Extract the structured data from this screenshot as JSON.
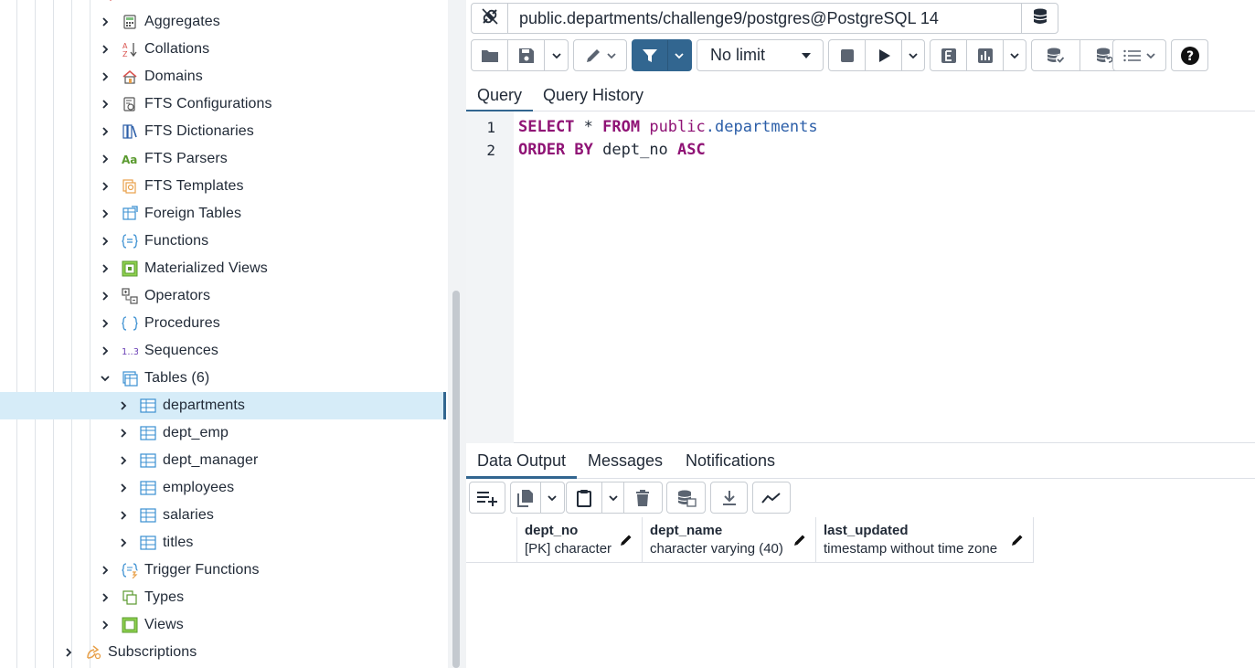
{
  "tree": {
    "items": [
      {
        "label": "Aggregates",
        "icon": "aggregate-icon",
        "expanded": false
      },
      {
        "label": "Collations",
        "icon": "collation-icon",
        "expanded": false
      },
      {
        "label": "Domains",
        "icon": "domain-icon",
        "expanded": false
      },
      {
        "label": "FTS Configurations",
        "icon": "fts-configuration-icon",
        "expanded": false
      },
      {
        "label": "FTS Dictionaries",
        "icon": "fts-dictionary-icon",
        "expanded": false
      },
      {
        "label": "FTS Parsers",
        "icon": "fts-parser-icon",
        "expanded": false
      },
      {
        "label": "FTS Templates",
        "icon": "fts-template-icon",
        "expanded": false
      },
      {
        "label": "Foreign Tables",
        "icon": "foreign-table-icon",
        "expanded": false
      },
      {
        "label": "Functions",
        "icon": "function-icon",
        "expanded": false
      },
      {
        "label": "Materialized Views",
        "icon": "materialized-view-icon",
        "expanded": false
      },
      {
        "label": "Operators",
        "icon": "operator-icon",
        "expanded": false
      },
      {
        "label": "Procedures",
        "icon": "procedure-icon",
        "expanded": false
      },
      {
        "label": "Sequences",
        "icon": "sequence-icon",
        "expanded": false
      },
      {
        "label": "Tables (6)",
        "icon": "tables-icon",
        "expanded": true
      }
    ],
    "tables": [
      {
        "label": "departments",
        "selected": true
      },
      {
        "label": "dept_emp",
        "selected": false
      },
      {
        "label": "dept_manager",
        "selected": false
      },
      {
        "label": "employees",
        "selected": false
      },
      {
        "label": "salaries",
        "selected": false
      },
      {
        "label": "titles",
        "selected": false
      }
    ],
    "after": [
      {
        "label": "Trigger Functions",
        "icon": "trigger-function-icon"
      },
      {
        "label": "Types",
        "icon": "type-icon"
      },
      {
        "label": "Views",
        "icon": "view-icon"
      }
    ],
    "subscriptions": {
      "label": "Subscriptions",
      "icon": "subscription-icon"
    }
  },
  "connection": {
    "text": "public.departments/challenge9/postgres@PostgreSQL 14"
  },
  "toolbar": {
    "limit": "No limit"
  },
  "query_tabs": [
    "Query",
    "Query History"
  ],
  "editor": {
    "line_numbers": [
      "1",
      "2"
    ],
    "line1": {
      "kw1": "SELECT",
      "star": " * ",
      "kw2": "FROM",
      "schema": " public",
      "dot": ".",
      "table": "departments"
    },
    "line2": {
      "kw1": "ORDER",
      "kw2": " BY",
      "col": " dept_no ",
      "kw3": "ASC"
    }
  },
  "output_tabs": [
    "Data Output",
    "Messages",
    "Notifications"
  ],
  "grid": {
    "columns": [
      {
        "name": "dept_no",
        "type": "[PK] character"
      },
      {
        "name": "dept_name",
        "type": "character varying (40)"
      },
      {
        "name": "last_updated",
        "type": "timestamp without time zone"
      }
    ]
  },
  "colors": {
    "accent": "#326690",
    "selected_row": "#d6ecf8",
    "keyword": "#8f1375",
    "identifier_blue": "#2b5ea8"
  }
}
